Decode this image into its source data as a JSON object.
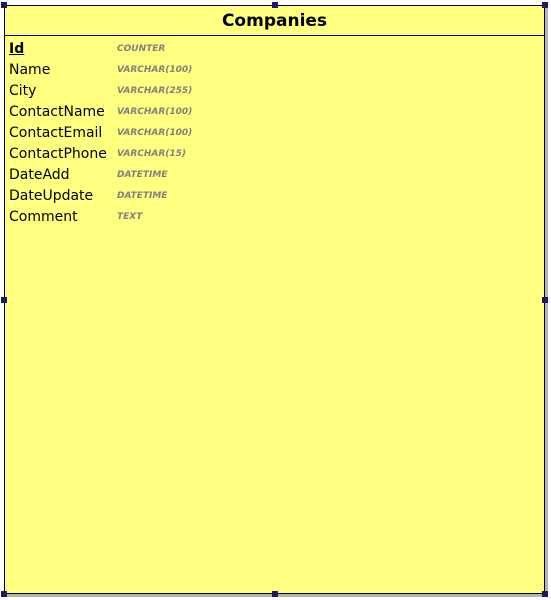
{
  "entity": {
    "title": "Companies",
    "fields": [
      {
        "name": "Id",
        "type": "COUNTER",
        "primary_key": true
      },
      {
        "name": "Name",
        "type": "VARCHAR(100)",
        "primary_key": false
      },
      {
        "name": "City",
        "type": "VARCHAR(255)",
        "primary_key": false
      },
      {
        "name": "ContactName",
        "type": "VARCHAR(100)",
        "primary_key": false
      },
      {
        "name": "ContactEmail",
        "type": "VARCHAR(100)",
        "primary_key": false
      },
      {
        "name": "ContactPhone",
        "type": "VARCHAR(15)",
        "primary_key": false
      },
      {
        "name": "DateAdd",
        "type": "DATETIME",
        "primary_key": false
      },
      {
        "name": "DateUpdate",
        "type": "DATETIME",
        "primary_key": false
      },
      {
        "name": "Comment",
        "type": "TEXT",
        "primary_key": false
      }
    ]
  },
  "colors": {
    "entity_fill": "#ffff80",
    "border": "#000000",
    "type_text": "#808080",
    "handle": "#1a1a66"
  }
}
